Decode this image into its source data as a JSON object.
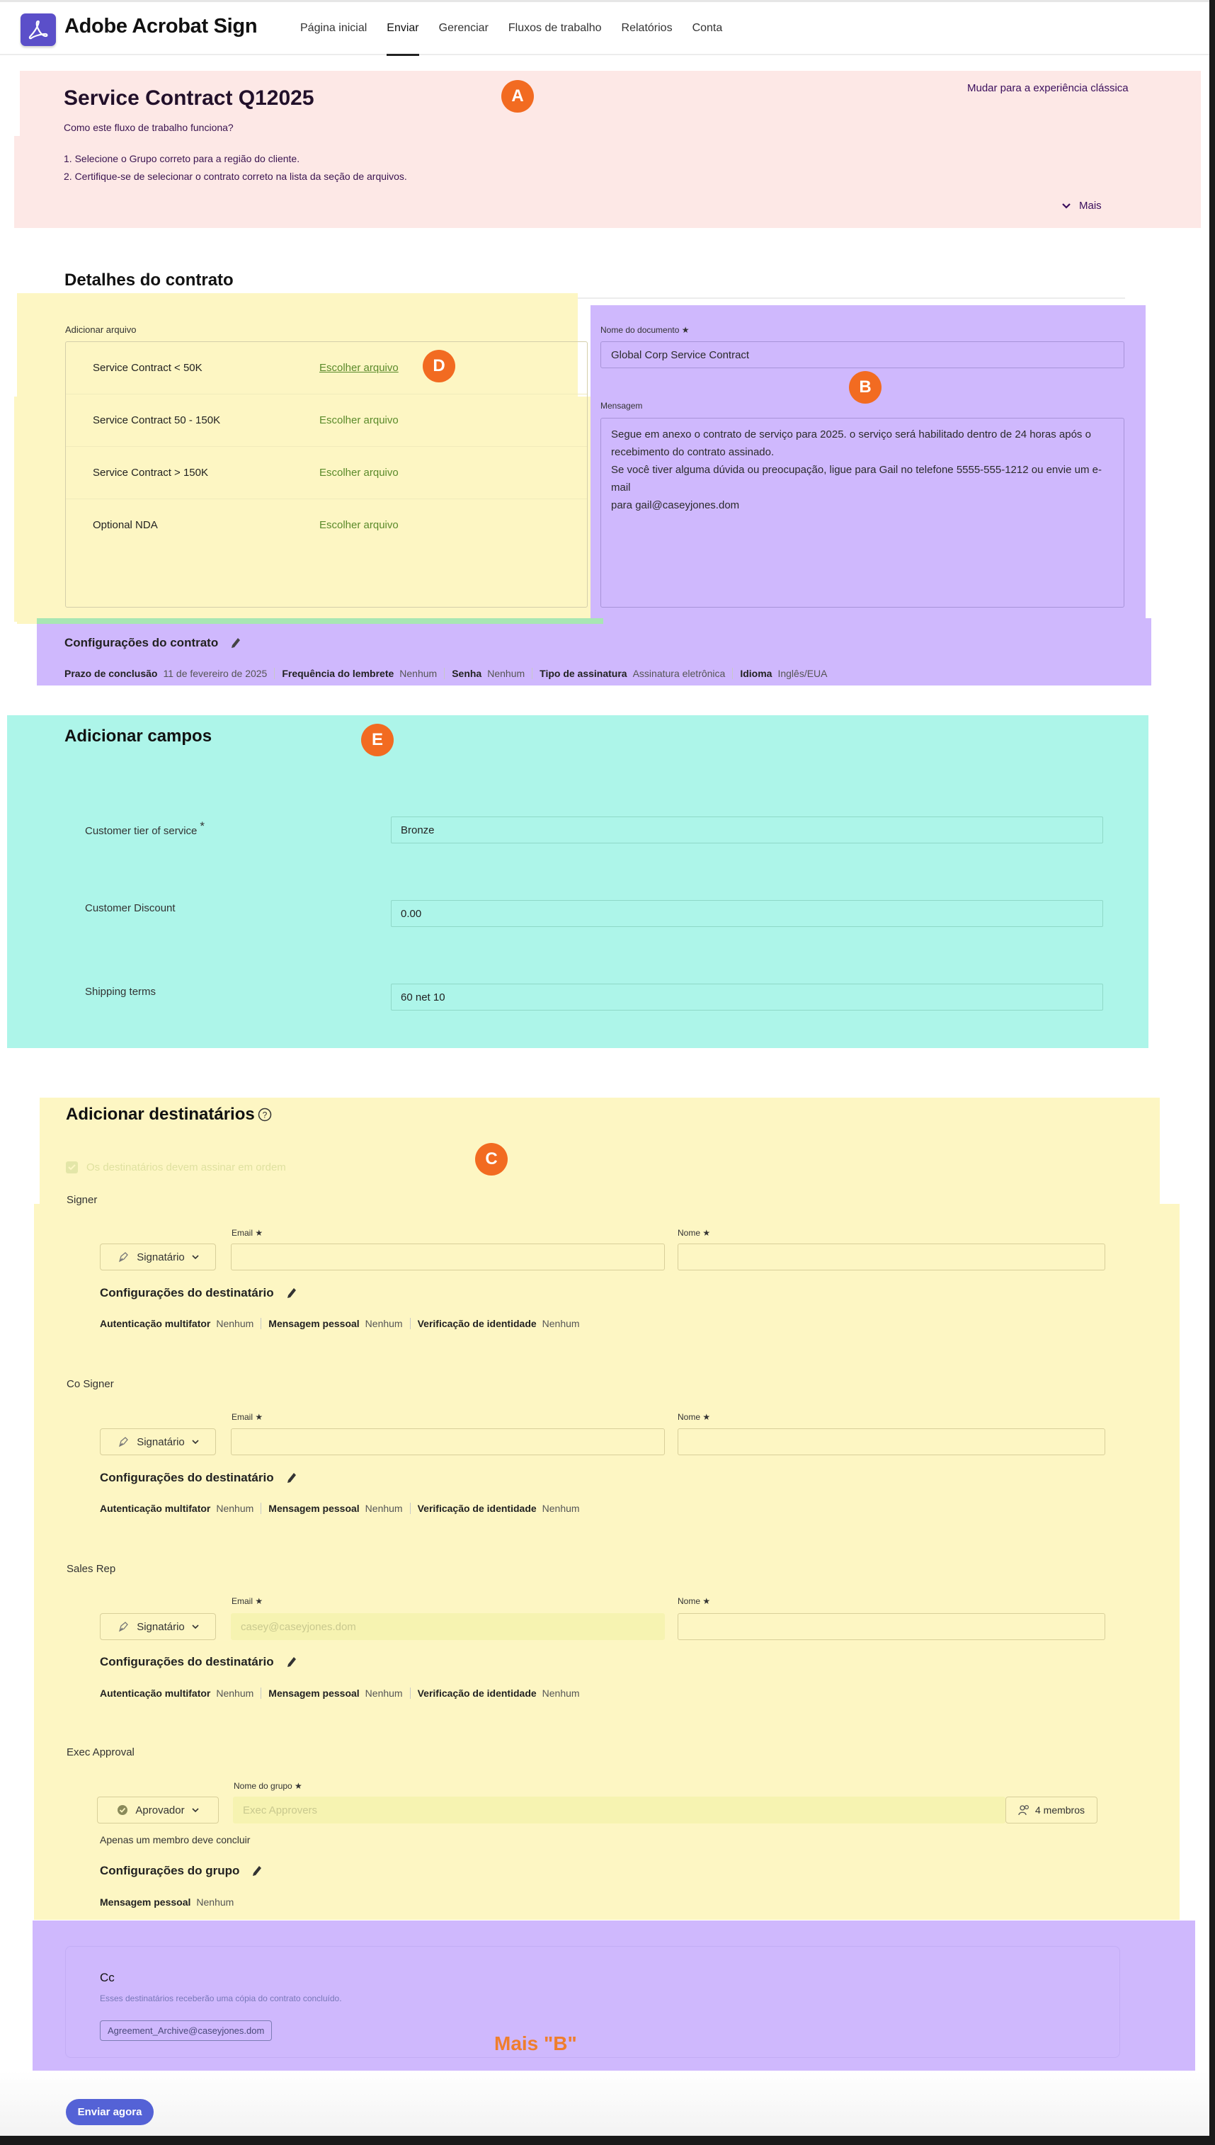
{
  "header": {
    "brand": "Adobe Acrobat Sign",
    "nav": [
      {
        "label": "Página inicial",
        "active": false
      },
      {
        "label": "Enviar",
        "active": true
      },
      {
        "label": "Gerenciar",
        "active": false
      },
      {
        "label": "Fluxos de trabalho",
        "active": false
      },
      {
        "label": "Relatórios",
        "active": false
      },
      {
        "label": "Conta",
        "active": false
      }
    ]
  },
  "banner": {
    "title": "Service Contract Q12025",
    "howto": "Como este fluxo de trabalho funciona?",
    "steps": [
      "1. Selecione o Grupo correto para a região do cliente.",
      "2. Certifique-se de selecionar o contrato correto na lista da seção de arquivos."
    ],
    "classic_link": "Mudar para a experiência clássica",
    "more_label": "Mais"
  },
  "badges": {
    "a": "A",
    "b": "B",
    "c": "C",
    "d": "D",
    "e": "E",
    "more_b": "Mais \"B\""
  },
  "contract_details": {
    "heading": "Detalhes do contrato",
    "add_file_label": "Adicionar arquivo",
    "files": [
      {
        "name": "Service Contract < 50K",
        "action": "Escolher arquivo"
      },
      {
        "name": "Service Contract 50 - 150K",
        "action": "Escolher arquivo"
      },
      {
        "name": "Service Contract > 150K",
        "action": "Escolher arquivo"
      },
      {
        "name": "Optional NDA",
        "action": "Escolher arquivo"
      }
    ],
    "doc_name_label": "Nome do documento",
    "doc_name_value": "Global Corp Service Contract",
    "message_label": "Mensagem",
    "message_lines": [
      "Segue em anexo o contrato de serviço para 2025. o serviço será habilitado dentro de 24 horas após o",
      "recebimento do contrato assinado.",
      "Se você tiver alguma dúvida ou preocupação, ligue para Gail no telefone 5555-555-1212 ou envie um e-mail",
      "para gail@caseyjones.dom"
    ],
    "settings_title": "Configurações do contrato",
    "settings": [
      {
        "key": "Prazo de conclusão",
        "value": "11 de fevereiro de 2025"
      },
      {
        "key": "Frequência do lembrete",
        "value": "Nenhum"
      },
      {
        "key": "Senha",
        "value": "Nenhum"
      },
      {
        "key": "Tipo de assinatura",
        "value": "Assinatura eletrônica"
      },
      {
        "key": "Idioma",
        "value": "Inglês/EUA"
      }
    ]
  },
  "fields": {
    "heading": "Adicionar campos",
    "items": [
      {
        "label": "Customer tier of service",
        "required": "*",
        "value": "Bronze"
      },
      {
        "label": "Customer Discount",
        "required": "",
        "value": "0.00"
      },
      {
        "label": "Shipping terms",
        "required": "",
        "value": "60 net 10"
      }
    ]
  },
  "recipients": {
    "heading": "Adicionar destinatários",
    "sign_in_order": "Os destinatários devem assinar em ordem",
    "email_label": "Email ★",
    "name_label": "Nome ★",
    "settings_title": "Configurações do destinatário",
    "list": [
      {
        "label": "Signer",
        "role": "Signatário",
        "email": "",
        "name": "",
        "settings": [
          {
            "key": "Autenticação multifator",
            "value": "Nenhum"
          },
          {
            "key": "Mensagem pessoal",
            "value": "Nenhum"
          },
          {
            "key": "Verificação de identidade",
            "value": "Nenhum"
          }
        ]
      },
      {
        "label": "Co Signer",
        "role": "Signatário",
        "email": "",
        "name": "",
        "settings": [
          {
            "key": "Autenticação multifator",
            "value": "Nenhum"
          },
          {
            "key": "Mensagem pessoal",
            "value": "Nenhum"
          },
          {
            "key": "Verificação de identidade",
            "value": "Nenhum"
          }
        ]
      },
      {
        "label": "Sales Rep",
        "role": "Signatário",
        "email": "casey@caseyjones.dom",
        "name": "",
        "settings": [
          {
            "key": "Autenticação multifator",
            "value": "Nenhum"
          },
          {
            "key": "Mensagem pessoal",
            "value": "Nenhum"
          },
          {
            "key": "Verificação de identidade",
            "value": "Nenhum"
          }
        ]
      }
    ],
    "group": {
      "label": "Exec Approval",
      "role": "Aprovador",
      "group_name_label": "Nome do grupo ★",
      "group_name_value": "Exec Approvers",
      "members": "4 membros",
      "completion_note": "Apenas um membro deve concluir",
      "settings_title": "Configurações do grupo",
      "settings": [
        {
          "key": "Mensagem pessoal",
          "value": "Nenhum"
        }
      ]
    },
    "cc": {
      "title": "Cc",
      "description": "Esses destinatários receberão uma cópia do contrato concluído.",
      "chip": "Agreement_Archive@caseyjones.dom"
    }
  },
  "footer": {
    "send_label": "Enviar agora"
  },
  "colors": {
    "brand": "#5b4fc9",
    "send": "#5462d6",
    "badge": "#f26b21",
    "link_green": "#5a8a2a"
  }
}
